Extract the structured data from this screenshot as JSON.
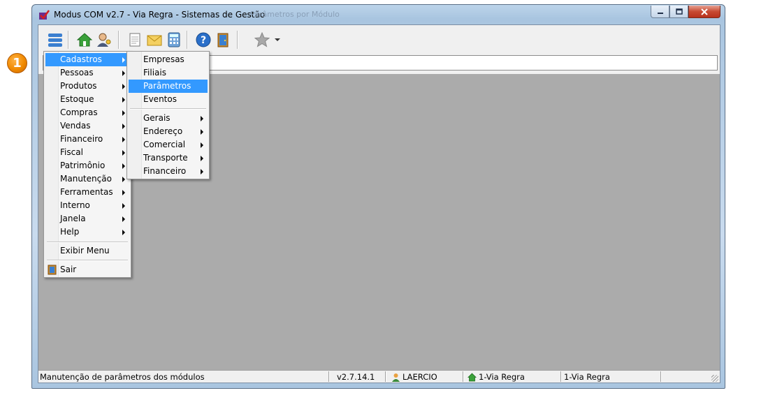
{
  "callout": {
    "number": "1"
  },
  "window": {
    "title": "Modus COM v2.7 - Via Regra - Sistemas de Gestão",
    "title_ghost": "Parâmetros por Módulo"
  },
  "toolbar": {
    "icons": [
      "menu-icon",
      "home-icon",
      "users-key-icon",
      "document-icon",
      "mail-icon",
      "calculator-icon",
      "help-icon",
      "exit-door-icon",
      "favorite-star-icon",
      "dropdown-arrow-icon"
    ]
  },
  "main_menu": {
    "items": [
      {
        "label": "Cadastros",
        "submenu": true
      },
      {
        "label": "Pessoas",
        "submenu": true
      },
      {
        "label": "Produtos",
        "submenu": true
      },
      {
        "label": "Estoque",
        "submenu": true
      },
      {
        "label": "Compras",
        "submenu": true
      },
      {
        "label": "Vendas",
        "submenu": true
      },
      {
        "label": "Financeiro",
        "submenu": true
      },
      {
        "label": "Fiscal",
        "submenu": true
      },
      {
        "label": "Patrimônio",
        "submenu": true
      },
      {
        "label": "Manutenção",
        "submenu": true
      },
      {
        "label": "Ferramentas",
        "submenu": true
      },
      {
        "label": "Interno",
        "submenu": true
      },
      {
        "label": "Janela",
        "submenu": true
      },
      {
        "label": "Help",
        "submenu": true
      }
    ],
    "show_menu": "Exibir Menu",
    "exit": "Sair"
  },
  "cadastros_menu": {
    "items": [
      "Empresas",
      "Filiais",
      "Parâmetros",
      "Eventos"
    ],
    "groups": [
      "Gerais",
      "Endereço",
      "Comercial",
      "Transporte",
      "Financeiro"
    ]
  },
  "statusbar": {
    "message": "Manutenção de parâmetros dos módulos",
    "version": "v2.7.14.1",
    "user": "LAERCIO",
    "company_home": "1-Via Regra",
    "company": "1-Via Regra"
  },
  "colors": {
    "highlight": "#3399ff",
    "workspace": "#ababab",
    "callout": "#f08a00"
  }
}
